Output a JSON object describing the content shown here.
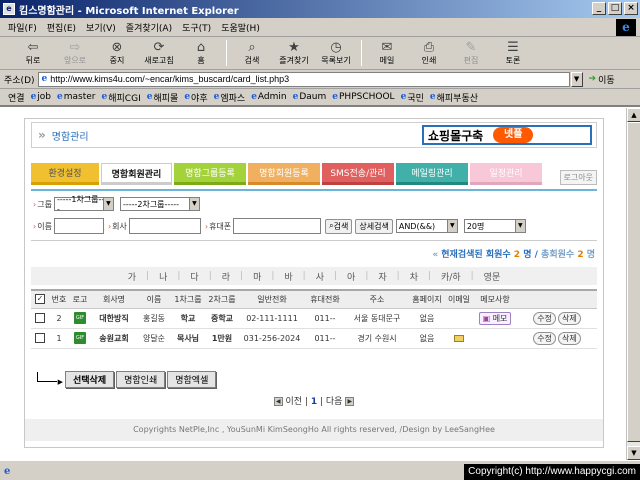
{
  "window": {
    "title": "킴스명함관리 - Microsoft Internet Explorer",
    "buttons": [
      "_",
      "□",
      "×"
    ]
  },
  "menu": [
    "파일(F)",
    "편집(E)",
    "보기(V)",
    "즐겨찾기(A)",
    "도구(T)",
    "도움말(H)"
  ],
  "toolbar": {
    "back": "뒤로",
    "forward": "앞으로",
    "stop": "중지",
    "refresh": "새로고침",
    "home": "홈",
    "search": "검색",
    "favorites": "즐겨찾기",
    "history": "목록보기",
    "mail": "메일",
    "print": "인쇄",
    "edit": "편집",
    "discuss": "토론"
  },
  "address": {
    "label": "주소(D)",
    "url": "http://www.kims4u.com/~encar/kims_buscard/card_list.php3",
    "go": "이동"
  },
  "links": {
    "label": "연결",
    "items": [
      "job",
      "master",
      "해피CGI",
      "해피몰",
      "야후",
      "엠파스",
      "Admin",
      "Daum",
      "PHPSCHOOL",
      "국민",
      "해피부동산"
    ]
  },
  "header": {
    "title": "명함관리",
    "banner_text": "쇼핑몰구축",
    "banner_logo": "넷플"
  },
  "tabs": [
    "환경설정",
    "명함회원관리",
    "명함그룹등록",
    "명함회원등록",
    "SMS전송/관리",
    "메일링관리",
    "일정관리"
  ],
  "logout": "로그아웃",
  "filters": {
    "group_label": "그룹",
    "group1": "-----1차그룹-----",
    "group2": "-----2차그룹-----",
    "name_label": "이름",
    "company_label": "회사",
    "phone_label": "휴대폰",
    "search_btn": "검색",
    "detail_btn": "상세검색",
    "logic": "AND(&&)",
    "per_page": "20명"
  },
  "counts": {
    "prefix": "현재검색된 회원수",
    "found": "2",
    "unit1": "명 /",
    "total_label": "총회원수",
    "total": "2",
    "unit2": "명"
  },
  "index_letters": [
    "가",
    "나",
    "다",
    "라",
    "마",
    "바",
    "사",
    "아",
    "자",
    "차",
    "카/하",
    "영문"
  ],
  "table": {
    "headers": [
      "",
      "번호",
      "로고",
      "회사명",
      "이름",
      "1차그룹",
      "2차그룹",
      "일반전화",
      "휴대전화",
      "주소",
      "홈페이지",
      "이메일",
      "메모사항",
      ""
    ],
    "rows": [
      {
        "num": "2",
        "company": "대한방직",
        "name": "홍길동",
        "g1": "학교",
        "g2": "중학교",
        "phone": "02-111-1111",
        "mobile": "011--",
        "address": "서울 동대문구",
        "homepage": "없음",
        "email": "",
        "memo": "메모",
        "edit": "수정",
        "del": "삭제"
      },
      {
        "num": "1",
        "company": "송원교회",
        "name": "양달순",
        "g1": "목사님",
        "g2": "1만원",
        "phone": "031-256-2024",
        "mobile": "011--",
        "address": "경기 수원시",
        "homepage": "없음",
        "email": "✉",
        "memo": "",
        "edit": "수정",
        "del": "삭제"
      }
    ]
  },
  "actions": {
    "delete_sel": "선택삭제",
    "print": "명함인쇄",
    "excel": "명함엑셀"
  },
  "pager": {
    "prev": "이전",
    "current": "1",
    "next": "다음"
  },
  "footer": "Copyrights NetPle,Inc , YouSunMi KimSeongHo All rights reserved, /Design by LeeSangHee",
  "overlay_copyright": "Copyright(c) http://www.happycgi.com"
}
